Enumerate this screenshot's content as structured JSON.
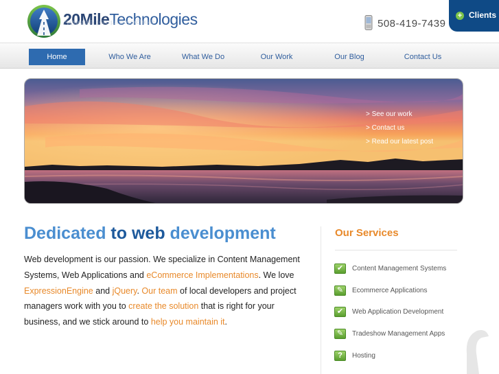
{
  "header": {
    "brand_number": "20Mile",
    "brand_rest": "Technologies",
    "phone": "508-419-7439",
    "clients_label": "Clients",
    "clients_icon": "plus-circle-icon"
  },
  "nav": {
    "items": [
      {
        "label": "Home",
        "active": true
      },
      {
        "label": "Who We Are",
        "active": false
      },
      {
        "label": "What We Do",
        "active": false
      },
      {
        "label": "Our Work",
        "active": false
      },
      {
        "label": "Our Blog",
        "active": false
      },
      {
        "label": "Contact Us",
        "active": false
      }
    ]
  },
  "hero": {
    "links": [
      "> See our work",
      "> Contact us",
      "> Read our latest post"
    ]
  },
  "main": {
    "heading_parts": [
      "Dedicated",
      " to ",
      "web",
      " development"
    ],
    "paragraph": {
      "t1": "Web development is our passion. We specialize in Content Management Systems, Web Applications and ",
      "h1": "eCommerce Implementations",
      "t2": ". We love ",
      "h2": "ExpressionEngine",
      "t3": " and ",
      "h3": "jQuery",
      "t4": ". ",
      "h4": "Our team",
      "t5": " of local developers and project managers work with you to ",
      "h5": "create the solution",
      "t6": " that is right for your business, and we stick around to ",
      "h6": "help you maintain it",
      "t7": "."
    }
  },
  "services": {
    "title": "Our Services",
    "items": [
      {
        "label": "Content Management Systems",
        "icon": "check-icon"
      },
      {
        "label": "Ecommerce Applications",
        "icon": "pencil-icon"
      },
      {
        "label": "Web Application Development",
        "icon": "check-icon"
      },
      {
        "label": "Tradeshow Management Apps",
        "icon": "pencil-icon"
      },
      {
        "label": "Hosting",
        "icon": "question-icon"
      }
    ]
  },
  "colors": {
    "brand_blue": "#2e6bb0",
    "accent_orange": "#e8892a",
    "clients_bg": "#0f4a86",
    "service_green": "#5a9e2f"
  }
}
